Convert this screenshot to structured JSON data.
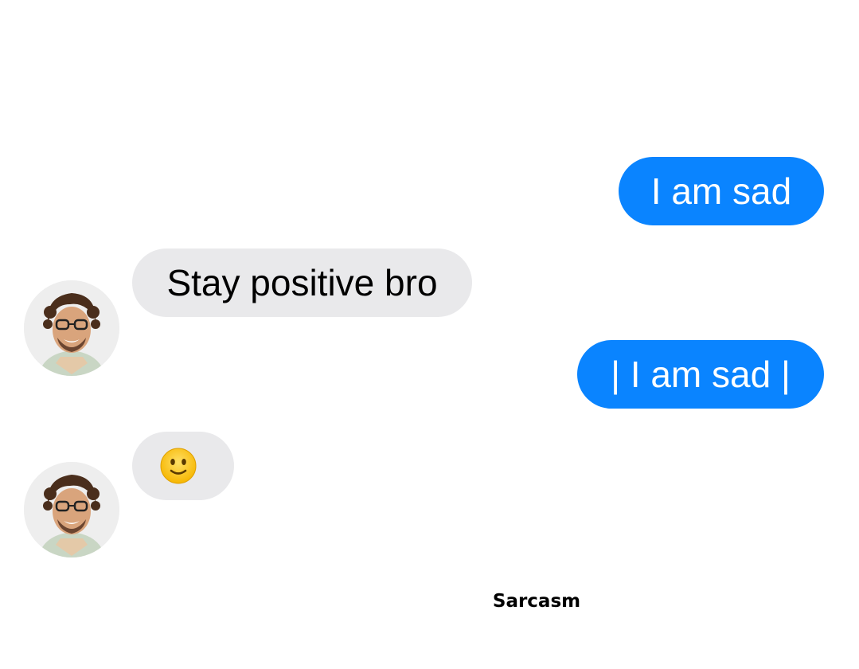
{
  "thread": {
    "messages": [
      {
        "sender": "me",
        "text": "I am sad"
      },
      {
        "sender": "friend",
        "text": "Stay positive bro"
      },
      {
        "sender": "me",
        "text": "| I am sad |"
      },
      {
        "sender": "friend",
        "text": "",
        "icon": "slightly-smiling-face-emoji"
      }
    ]
  },
  "caption": "Sarcasm",
  "colors": {
    "sent_bubble": "#0a84ff",
    "received_bubble": "#e9e9eb",
    "background": "#ffffff"
  }
}
